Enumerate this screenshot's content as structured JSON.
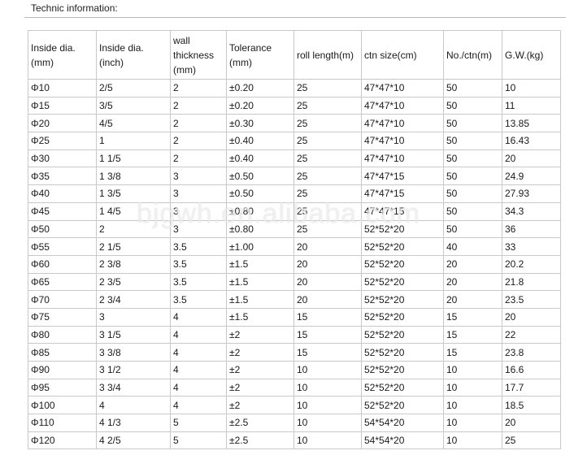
{
  "caption": "Technic information:",
  "watermark": "bjgwh.en.alibaba.com",
  "table": {
    "headers": [
      "Inside dia.\n(mm)",
      "Inside dia.(inch)",
      "wall\nthickness\n(mm)",
      "Tolerance\n(mm)",
      "roll length(m)",
      "ctn size(cm)",
      "No./ctn(m)",
      "G.W.(kg)"
    ],
    "rows": [
      [
        "Φ10",
        "2/5",
        "2",
        "±0.20",
        "25",
        "47*47*10",
        "50",
        "10"
      ],
      [
        "Φ15",
        "3/5",
        "2",
        "±0.20",
        "25",
        "47*47*10",
        "50",
        "11"
      ],
      [
        "Φ20",
        "4/5",
        "2",
        "±0.30",
        "25",
        "47*47*10",
        "50",
        "13.85"
      ],
      [
        "Φ25",
        "1",
        "2",
        "±0.40",
        "25",
        "47*47*10",
        "50",
        "16.43"
      ],
      [
        "Φ30",
        "1 1/5",
        "2",
        "±0.40",
        "25",
        "47*47*10",
        "50",
        "20"
      ],
      [
        "Φ35",
        "1 3/8",
        "3",
        "±0.50",
        "25",
        "47*47*15",
        "50",
        "24.9"
      ],
      [
        "Φ40",
        "1 3/5",
        "3",
        "±0.50",
        "25",
        "47*47*15",
        "50",
        "27.93"
      ],
      [
        "Φ45",
        "1 4/5",
        "3",
        "±0.80",
        "25",
        "47*47*15",
        "50",
        "34.3"
      ],
      [
        "Φ50",
        "2",
        "3",
        "±0.80",
        "25",
        "52*52*20",
        "50",
        "36"
      ],
      [
        "Φ55",
        "2 1/5",
        "3.5",
        "±1.00",
        "20",
        "52*52*20",
        "40",
        "33"
      ],
      [
        "Φ60",
        "2 3/8",
        "3.5",
        "±1.5",
        "20",
        "52*52*20",
        "20",
        "20.2"
      ],
      [
        "Φ65",
        "2 3/5",
        "3.5",
        "±1.5",
        "20",
        "52*52*20",
        "20",
        "21.8"
      ],
      [
        "Φ70",
        "2 3/4",
        "3.5",
        "±1.5",
        "20",
        "52*52*20",
        "20",
        "23.5"
      ],
      [
        "Φ75",
        "3",
        "4",
        "±1.5",
        "15",
        "52*52*20",
        "15",
        "20"
      ],
      [
        "Φ80",
        "3 1/5",
        "4",
        "±2",
        "15",
        "52*52*20",
        "15",
        "22"
      ],
      [
        "Φ85",
        "3 3/8",
        "4",
        "±2",
        "15",
        "52*52*20",
        "15",
        "23.8"
      ],
      [
        "Φ90",
        "3 1/2",
        "4",
        "±2",
        "10",
        "52*52*20",
        "10",
        "16.6"
      ],
      [
        "Φ95",
        "3 3/4",
        "4",
        "±2",
        "10",
        "52*52*20",
        "10",
        "17.7"
      ],
      [
        "Φ100",
        "4",
        "4",
        "±2",
        "10",
        "52*52*20",
        "10",
        "18.5"
      ],
      [
        "Φ110",
        "4 1/3",
        "5",
        "±2.5",
        "10",
        "54*54*20",
        "10",
        "20"
      ],
      [
        "Φ120",
        "4 2/5",
        "5",
        "±2.5",
        "10",
        "54*54*20",
        "10",
        "25"
      ]
    ]
  }
}
